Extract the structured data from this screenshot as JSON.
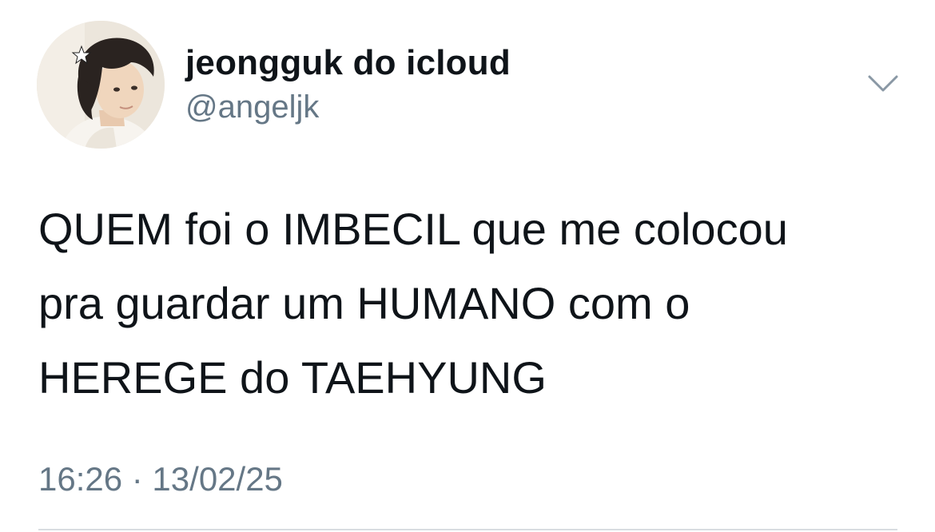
{
  "tweet": {
    "author": {
      "display_name": "jeongguk do icloud",
      "handle": "@angeljk",
      "avatar_icon": "profile-photo"
    },
    "text_lines": [
      "QUEM foi o IMBECIL que me colocou",
      "pra guardar um HUMANO com o",
      "HEREGE do TAEHYUNG"
    ],
    "timestamp": "16:26 · 13/02/25",
    "menu_icon": "chevron-down-icon"
  },
  "colors": {
    "text_primary": "#0f1419",
    "text_secondary": "#657786",
    "divider": "#d8dde1",
    "background": "#ffffff"
  }
}
